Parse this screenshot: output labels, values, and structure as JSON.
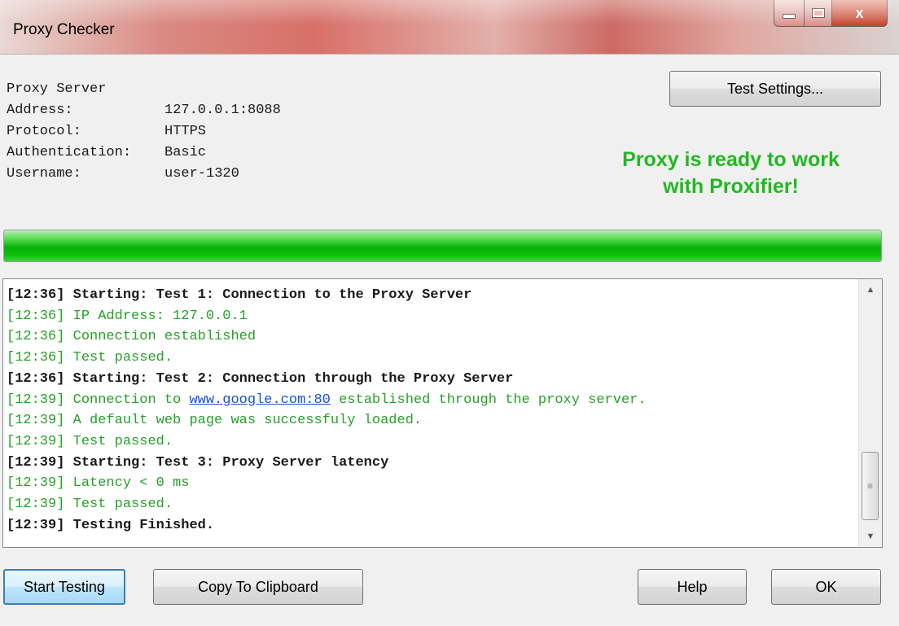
{
  "window": {
    "title": "Proxy Checker",
    "close_glyph": "x"
  },
  "proxy_info": {
    "heading": "Proxy Server",
    "rows": [
      {
        "label": "Address:",
        "value": "127.0.0.1:8088"
      },
      {
        "label": "Protocol:",
        "value": "HTTPS"
      },
      {
        "label": "Authentication:",
        "value": "Basic"
      },
      {
        "label": "Username:",
        "value": "user-1320"
      }
    ]
  },
  "buttons": {
    "test_settings": "Test Settings...",
    "start_testing": "Start Testing",
    "copy_to_clipboard": "Copy To Clipboard",
    "help": "Help",
    "ok": "OK"
  },
  "status": {
    "line1": "Proxy is ready to work",
    "line2": "with Proxifier!",
    "color": "#22b822"
  },
  "progress": {
    "percent": 100,
    "color": "#0cc00c"
  },
  "log": {
    "lines": [
      {
        "time": "[12:36]",
        "text": "Starting: Test 1: Connection to the Proxy Server",
        "style": "bold"
      },
      {
        "time": "[12:36]",
        "text": "IP Address: 127.0.0.1",
        "style": "green"
      },
      {
        "time": "[12:36]",
        "text": "Connection established",
        "style": "green"
      },
      {
        "time": "[12:36]",
        "text": "Test passed.",
        "style": "green"
      },
      {
        "time": "[12:36]",
        "text": "Starting: Test 2: Connection through the Proxy Server",
        "style": "bold"
      },
      {
        "time": "[12:39]",
        "text": "Connection to ",
        "link": "www.google.com:80",
        "text_after": " established through the proxy server.",
        "style": "green"
      },
      {
        "time": "[12:39]",
        "text": "A default web page was successfuly loaded.",
        "style": "green"
      },
      {
        "time": "[12:39]",
        "text": "Test passed.",
        "style": "green"
      },
      {
        "time": "[12:39]",
        "text": "Starting: Test 3: Proxy Server latency",
        "style": "bold"
      },
      {
        "time": "[12:39]",
        "text": "Latency < 0 ms",
        "style": "green"
      },
      {
        "time": "[12:39]",
        "text": "Test passed.",
        "style": "green"
      },
      {
        "time": "[12:39]",
        "text": "Testing Finished.",
        "style": "bold"
      }
    ]
  },
  "icons": {
    "minimize": "minimize-icon",
    "maximize": "maximize-icon",
    "close": "close-icon",
    "scroll_up": "scroll-up-arrow-icon",
    "scroll_down": "scroll-down-arrow-icon",
    "scroll_grip": "scroll-grip-icon"
  }
}
